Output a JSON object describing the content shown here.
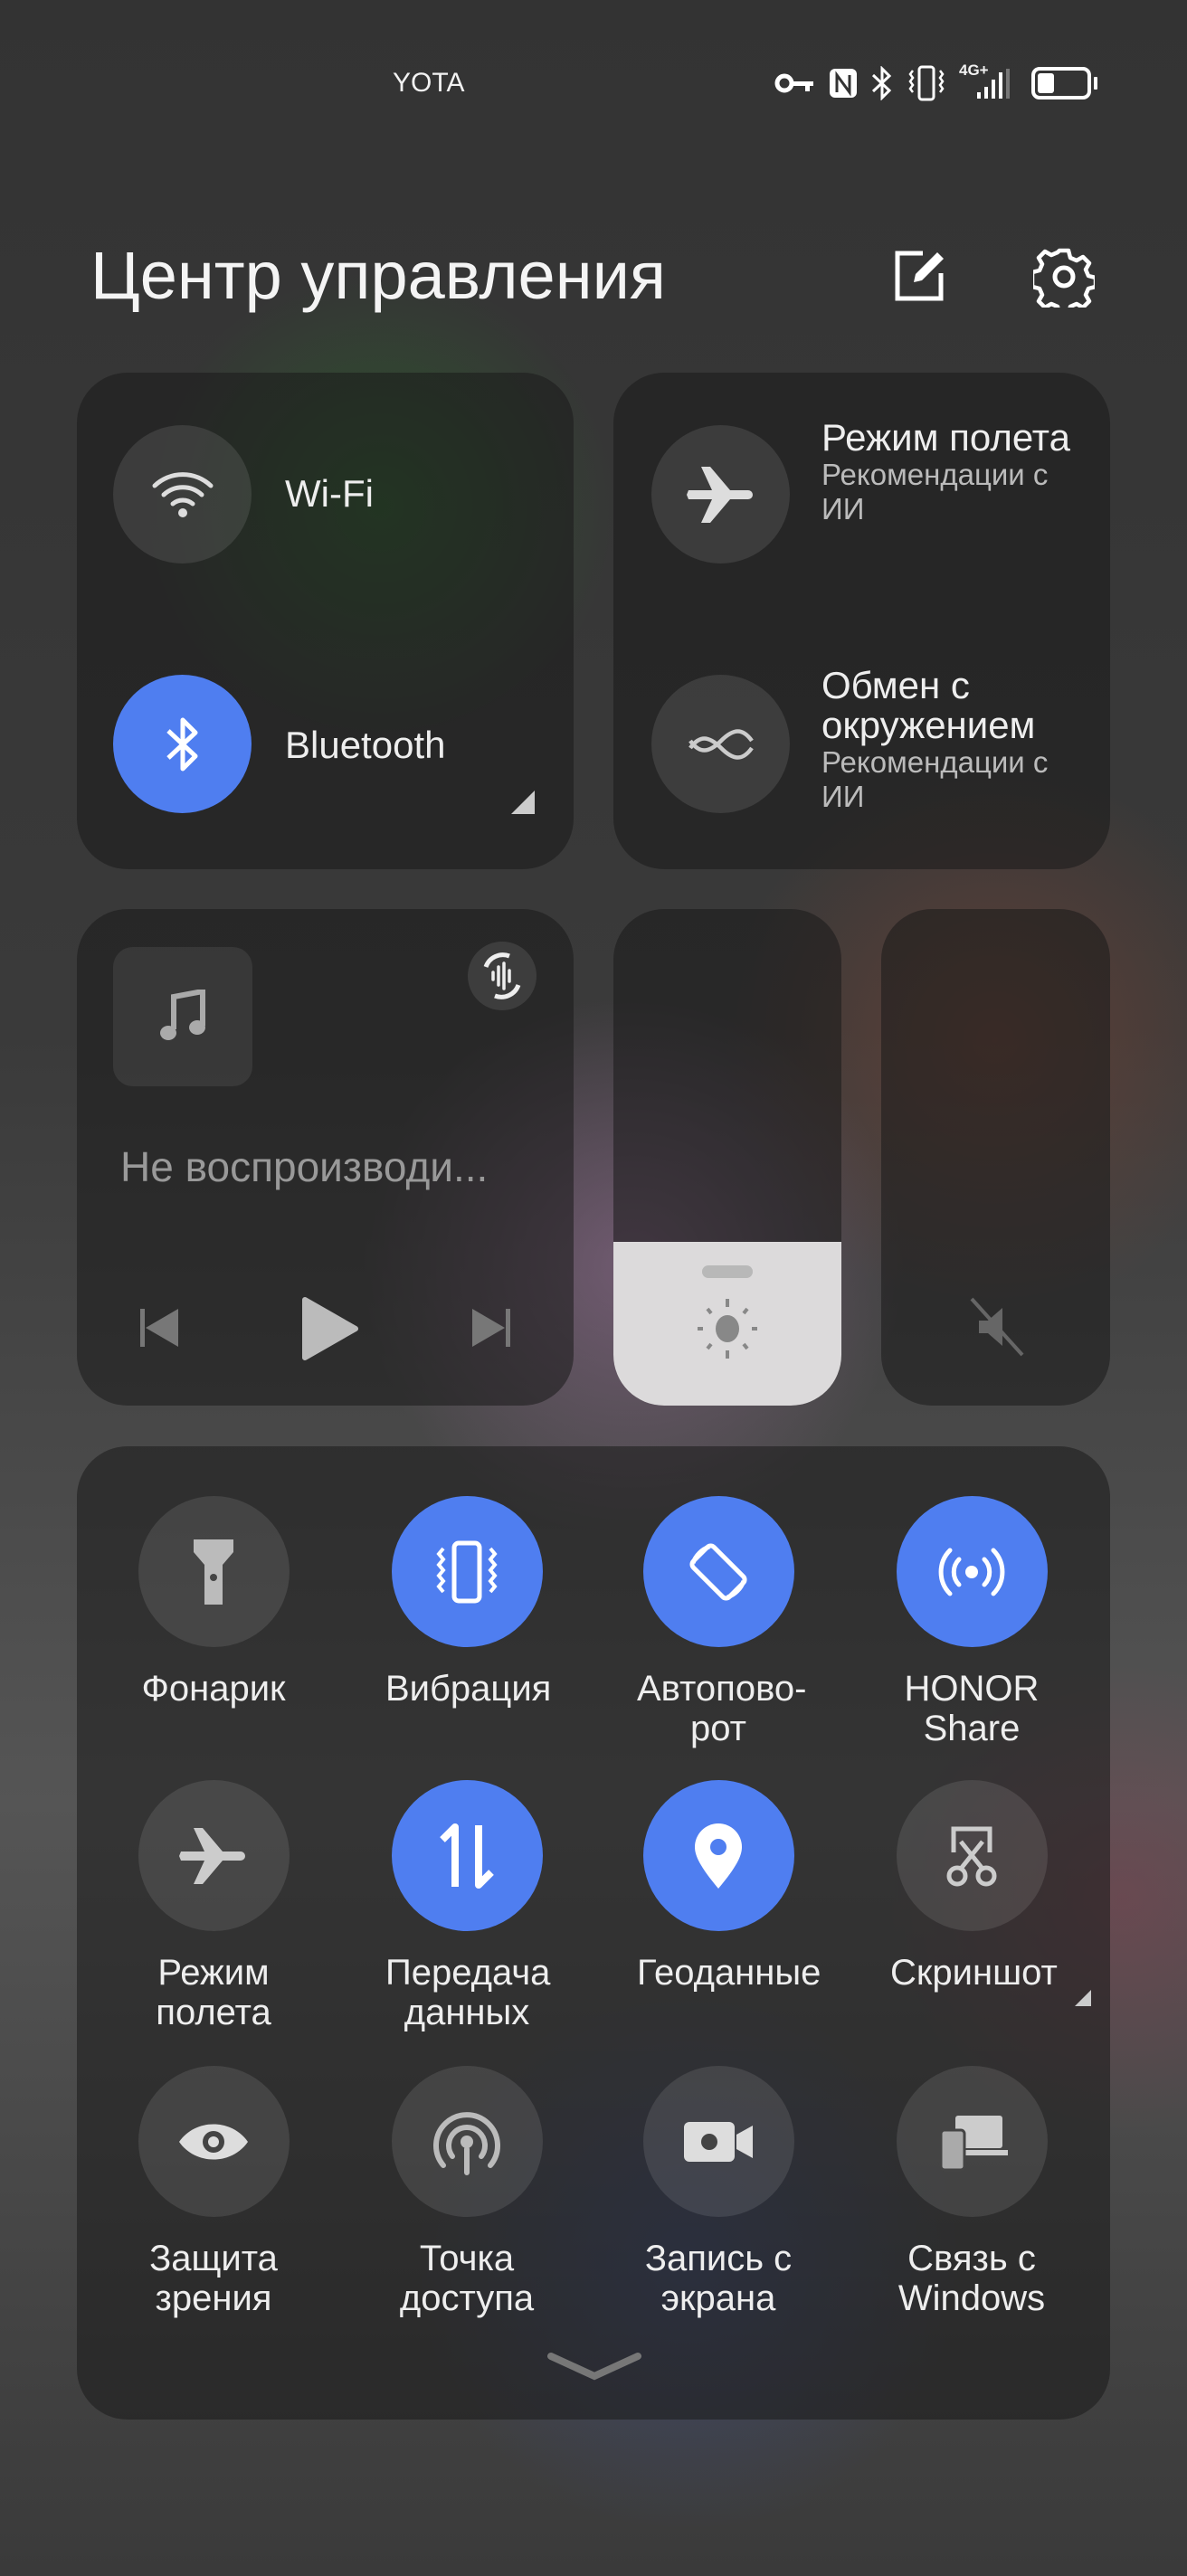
{
  "status_bar": {
    "carrier": "YOTA",
    "network": "4G+",
    "icons": [
      "vpn-key-icon",
      "nfc-icon",
      "bluetooth-icon",
      "vibrate-icon",
      "signal-icon",
      "battery-icon"
    ],
    "battery_level": 0.35
  },
  "header": {
    "title": "Центр управления",
    "edit_icon": "edit-icon",
    "settings_icon": "gear-icon"
  },
  "connectivity": {
    "wifi": {
      "label": "Wi-Fi",
      "on": false
    },
    "bluetooth": {
      "label": "Bluetooth",
      "on": true
    }
  },
  "smart": {
    "airplane": {
      "title": "Режим полета",
      "subtitle": "Рекомендации с ИИ"
    },
    "share": {
      "title": "Обмен с окружением",
      "subtitle": "Рекомендации с ИИ"
    }
  },
  "media": {
    "status": "Не воспроизводи..."
  },
  "sliders": {
    "brightness": 0.33,
    "volume": 0,
    "volume_muted": true
  },
  "toggles": [
    {
      "label": "Фонарик",
      "icon": "flashlight-icon",
      "on": false
    },
    {
      "label": "Вибрация",
      "icon": "vibrate-icon",
      "on": true
    },
    {
      "label": "Автопово-рот",
      "icon": "auto-rotate-icon",
      "on": true
    },
    {
      "label": "HONOR Share",
      "icon": "honor-share-icon",
      "on": true
    },
    {
      "label": "Режим полета",
      "icon": "airplane-icon",
      "on": false
    },
    {
      "label": "Передача данных",
      "icon": "mobile-data-icon",
      "on": true
    },
    {
      "label": "Геоданные",
      "icon": "location-icon",
      "on": true
    },
    {
      "label": "Скриншот",
      "icon": "screenshot-icon",
      "on": false
    },
    {
      "label": "Защита зрения",
      "icon": "eye-icon",
      "on": false
    },
    {
      "label": "Точка доступа",
      "icon": "hotspot-icon",
      "on": false
    },
    {
      "label": "Запись с экрана",
      "icon": "screen-record-icon",
      "on": false
    },
    {
      "label": "Связь с Windows",
      "icon": "windows-link-icon",
      "on": false
    }
  ],
  "colors": {
    "accent": "#4f7ef0"
  }
}
